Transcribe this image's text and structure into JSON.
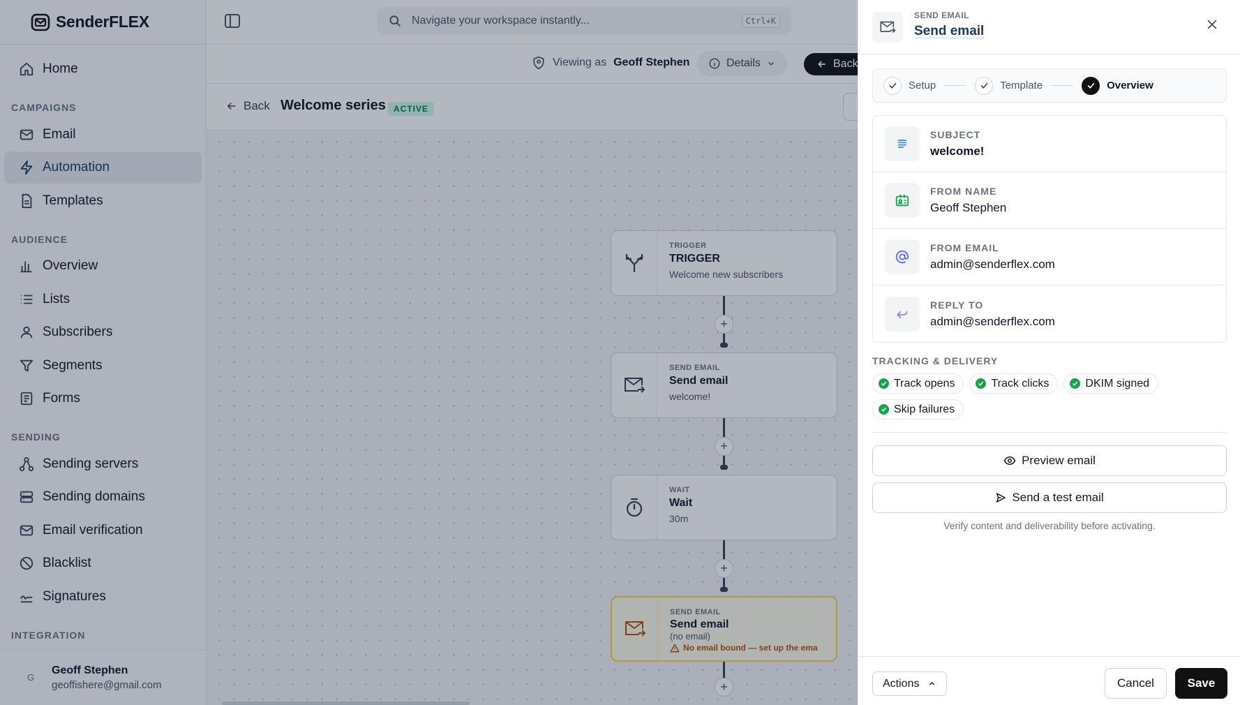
{
  "app": {
    "name": "SenderFLEX"
  },
  "sidebar": {
    "home": "Home",
    "sections": {
      "campaigns": "CAMPAIGNS",
      "audience": "AUDIENCE",
      "sending": "SENDING",
      "integration": "INTEGRATION"
    },
    "campaigns": [
      "Email",
      "Automation",
      "Templates"
    ],
    "audience": [
      "Overview",
      "Lists",
      "Subscribers",
      "Segments",
      "Forms"
    ],
    "sending": [
      "Sending servers",
      "Sending domains",
      "Email verification",
      "Blacklist",
      "Signatures"
    ],
    "active_item": "Automation",
    "user": {
      "initial": "G",
      "name": "Geoff Stephen",
      "email": "geoffishere@gmail.com"
    }
  },
  "topbar": {
    "search_placeholder": "Navigate your workspace instantly...",
    "shortcut": "Ctrl+K"
  },
  "subbar": {
    "viewing_prefix": "Viewing as",
    "viewing_user": "Geoff Stephen",
    "details_label": "Details",
    "back_label": "Back"
  },
  "header": {
    "back_label": "Back",
    "title": "Welcome series",
    "status": "ACTIVE"
  },
  "flow": {
    "nodes": [
      {
        "kicker": "TRIGGER",
        "title": "TRIGGER",
        "subtitle": "Welcome new subscribers",
        "icon": "split-arrows-icon"
      },
      {
        "kicker": "SEND EMAIL",
        "title": "Send email",
        "subtitle": "welcome!",
        "icon": "mail-send-icon"
      },
      {
        "kicker": "WAIT",
        "title": "Wait",
        "subtitle": "30m",
        "icon": "stopwatch-icon"
      },
      {
        "kicker": "SEND EMAIL",
        "title": "Send email",
        "subtitle": "(no email)",
        "warning": "No email bound — set up the ema",
        "icon": "mail-send-icon"
      }
    ],
    "add_symbol": "+"
  },
  "panel": {
    "kicker": "SEND EMAIL",
    "title": "Send email",
    "steps": [
      {
        "label": "Setup",
        "state": "done"
      },
      {
        "label": "Template",
        "state": "done"
      },
      {
        "label": "Overview",
        "state": "current"
      }
    ],
    "fields": [
      {
        "label": "SUBJECT",
        "value": "welcome!",
        "icon": "text-lines-icon"
      },
      {
        "label": "FROM NAME",
        "value": "Geoff Stephen",
        "icon": "contact-card-icon"
      },
      {
        "label": "FROM EMAIL",
        "value": "admin@senderflex.com",
        "icon": "at-sign-icon"
      },
      {
        "label": "REPLY TO",
        "value": "admin@senderflex.com",
        "icon": "reply-icon"
      }
    ],
    "tracking_label": "TRACKING & DELIVERY",
    "tracking": [
      "Track opens",
      "Track clicks",
      "DKIM signed",
      "Skip failures"
    ],
    "preview_label": "Preview email",
    "test_label": "Send a test email",
    "hint": "Verify content and deliverability before activating.",
    "footer": {
      "actions": "Actions",
      "cancel": "Cancel",
      "save": "Save"
    }
  },
  "colors": {
    "accent": "#1e3a5f",
    "active_badge": "#047857",
    "success": "#16a34a",
    "warning": "#b45309"
  }
}
